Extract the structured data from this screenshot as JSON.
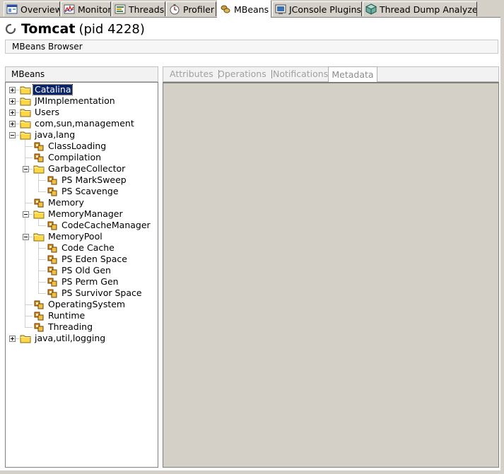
{
  "tabs": [
    {
      "label": "Overview",
      "icon": "overview-icon"
    },
    {
      "label": "Monitor",
      "icon": "monitor-icon"
    },
    {
      "label": "Threads",
      "icon": "threads-icon"
    },
    {
      "label": "Profiler",
      "icon": "profiler-icon"
    },
    {
      "label": "MBeans",
      "icon": "mbeans-icon",
      "active": true
    },
    {
      "label": "JConsole Plugins",
      "icon": "jconsole-plugins-icon"
    },
    {
      "label": "Thread Dump Analyzer",
      "icon": "thread-dump-icon"
    }
  ],
  "header": {
    "app_name": "Tomcat",
    "pid_text": "(pid 4228)"
  },
  "browser_title": "MBeans Browser",
  "tree": {
    "header": "MBeans",
    "nodes": [
      {
        "label": "Catalina",
        "depth": 0,
        "type": "folder",
        "state": "collapsed",
        "selected": true
      },
      {
        "label": "JMImplementation",
        "depth": 0,
        "type": "folder",
        "state": "collapsed"
      },
      {
        "label": "Users",
        "depth": 0,
        "type": "folder",
        "state": "collapsed"
      },
      {
        "label": "com,sun,management",
        "depth": 0,
        "type": "folder",
        "state": "collapsed"
      },
      {
        "label": "java,lang",
        "depth": 0,
        "type": "folder",
        "state": "expanded"
      },
      {
        "label": "ClassLoading",
        "depth": 1,
        "type": "bean"
      },
      {
        "label": "Compilation",
        "depth": 1,
        "type": "bean"
      },
      {
        "label": "GarbageCollector",
        "depth": 1,
        "type": "folder",
        "state": "expanded"
      },
      {
        "label": "PS MarkSweep",
        "depth": 2,
        "type": "bean"
      },
      {
        "label": "PS Scavenge",
        "depth": 2,
        "type": "bean"
      },
      {
        "label": "Memory",
        "depth": 1,
        "type": "bean"
      },
      {
        "label": "MemoryManager",
        "depth": 1,
        "type": "folder",
        "state": "expanded"
      },
      {
        "label": "CodeCacheManager",
        "depth": 2,
        "type": "bean"
      },
      {
        "label": "MemoryPool",
        "depth": 1,
        "type": "folder",
        "state": "expanded"
      },
      {
        "label": "Code Cache",
        "depth": 2,
        "type": "bean"
      },
      {
        "label": "PS Eden Space",
        "depth": 2,
        "type": "bean"
      },
      {
        "label": "PS Old Gen",
        "depth": 2,
        "type": "bean"
      },
      {
        "label": "PS Perm Gen",
        "depth": 2,
        "type": "bean"
      },
      {
        "label": "PS Survivor Space",
        "depth": 2,
        "type": "bean"
      },
      {
        "label": "OperatingSystem",
        "depth": 1,
        "type": "bean"
      },
      {
        "label": "Runtime",
        "depth": 1,
        "type": "bean"
      },
      {
        "label": "Threading",
        "depth": 1,
        "type": "bean"
      },
      {
        "label": "java,util,logging",
        "depth": 0,
        "type": "folder",
        "state": "collapsed"
      }
    ]
  },
  "detail_tabs": {
    "attributes": "Attributes",
    "operations": "Operations",
    "notifications": "Notifications",
    "metadata": "Metadata"
  },
  "colors": {
    "chrome": "#d4d0c8",
    "selection": "#0a246a",
    "folder": "#ffd84a",
    "disabled_text": "#a0a0a0"
  }
}
